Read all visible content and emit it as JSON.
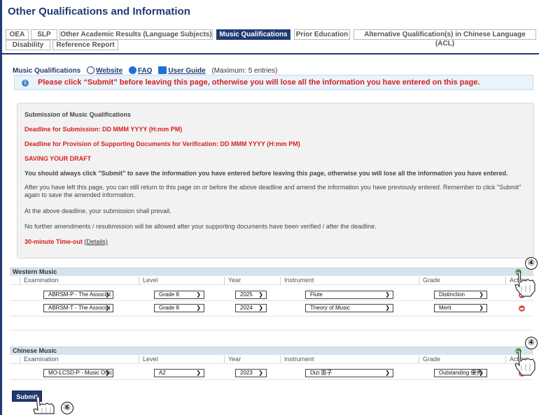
{
  "page": {
    "title": "Other Qualifications and Information"
  },
  "tabs": [
    {
      "label": "OEA",
      "active": false
    },
    {
      "label": "SLP",
      "active": false
    },
    {
      "label": "Other Academic Results (Language Subjects)",
      "active": false
    },
    {
      "label": "Music Qualifications",
      "active": true
    },
    {
      "label": "Prior Education",
      "active": false
    },
    {
      "label": "Alternative Qualification(s) in Chinese Language (ACL)",
      "active": false
    },
    {
      "label": "Disability",
      "active": false
    },
    {
      "label": "Reference Report",
      "active": false
    }
  ],
  "section": {
    "title": "Music Qualifications",
    "website_link": "Website",
    "faq_link": "FAQ",
    "guide_link": "User Guide",
    "max_note": "(Maximum: 5 entries)",
    "icons": [
      "globe-icon",
      "faq-icon",
      "book-icon"
    ]
  },
  "alert": {
    "icon": "info-icon",
    "text": "Please click “Submit” before leaving this page, otherwise you will lose all the information you have entered on this page."
  },
  "info": {
    "heading": "Submission of Music Qualifications",
    "deadline_submission": "Deadline for Submission: DD MMM YYYY (H:mm PM)",
    "deadline_documents": "Deadline for Provision of Supporting Documents for Verification: DD MMM YYYY (H:mm PM)",
    "draft_heading": "SAVING YOUR DRAFT",
    "draft_bold": "You should always click \"Submit\" to save the information you have entered before leaving this page, otherwise you will lose all the information you have entered.",
    "para1": "After you have left this page, you can still return to this page on or before the above deadline and amend the information you have previously entered. Remember to click \"Submit\" again to save the amended information.",
    "para2": "At the above deadline, your submission shall prevail.",
    "para3": "No further amendments / resubmission will be allowed after your supporting documents have been verified / after the deadline.",
    "timeout_label": "30-minute Time-out",
    "timeout_link": "(Details)"
  },
  "columns": {
    "examination": "Examination",
    "level": "Level",
    "year": "Year",
    "instrument": "Instrument",
    "grade": "Grade",
    "action": "Action"
  },
  "western": {
    "title": "Western Music",
    "rows": [
      {
        "examination": "ABRSM-P - The Associat",
        "level": "Grade 8",
        "year": "2025",
        "instrument": "Flute",
        "grade": "Distinction"
      },
      {
        "examination": "ABRSM-T - The Associat",
        "level": "Grade 8",
        "year": "2024",
        "instrument": "Theory of Music",
        "grade": "Merit"
      }
    ]
  },
  "chinese": {
    "title": "Chinese Music",
    "rows": [
      {
        "examination": "MO-LCSD-P - Music Offic",
        "level": "A2",
        "year": "2023",
        "instrument": "Dizi 笛子",
        "grade": "Outstanding 優秀"
      }
    ]
  },
  "submit": {
    "label": "Submit"
  },
  "callouts": {
    "add_western": "④",
    "add_chinese": "④",
    "submit": "⑥"
  },
  "colors": {
    "primary": "#1f3b73",
    "alert_red": "#d61f1f",
    "group_header": "#d6e3ee",
    "add_green": "#59b04f",
    "remove_red": "#e05252"
  }
}
